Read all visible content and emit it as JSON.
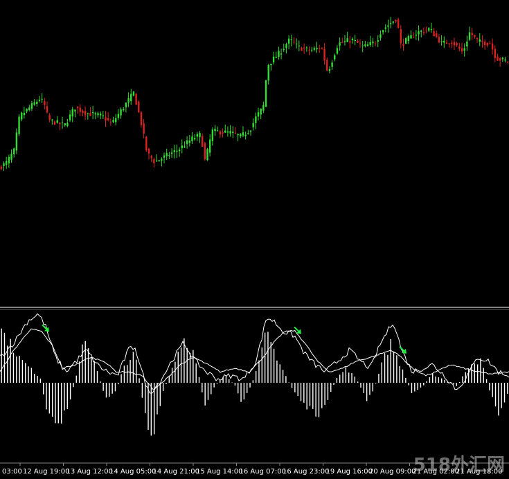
{
  "colors": {
    "background": "#000000",
    "bull": "#33dd33",
    "bear": "#dd2222",
    "separator": "#ffffff",
    "indicator": "#ffffff",
    "arrow": "#22ee44",
    "text": "#ffffff"
  },
  "watermark": "518外汇网",
  "chart_data": [
    {
      "type": "candlestick",
      "title": "",
      "grid": false,
      "ylim": [
        0,
        100
      ],
      "x_tick_labels": [
        "03:00",
        "12 Aug 19:00",
        "13 Aug 12:00",
        "14 Aug 05:00",
        "14 Aug 21:00",
        "15 Aug 14:00",
        "16 Aug 07:00",
        "16 Aug 23:00",
        "19 Aug 16:00",
        "20 Aug 09:00",
        "21 Aug 02:00",
        "21 Aug 18:00"
      ],
      "price_path": [
        [
          0,
          22
        ],
        [
          10,
          24
        ],
        [
          22,
          31
        ],
        [
          30,
          50
        ],
        [
          45,
          55
        ],
        [
          60,
          60
        ],
        [
          66,
          56
        ],
        [
          72,
          48
        ],
        [
          95,
          45
        ],
        [
          110,
          55
        ],
        [
          125,
          52
        ],
        [
          150,
          50
        ],
        [
          163,
          46
        ],
        [
          180,
          55
        ],
        [
          195,
          63
        ],
        [
          206,
          46
        ],
        [
          214,
          30
        ],
        [
          225,
          25
        ],
        [
          240,
          28
        ],
        [
          260,
          32
        ],
        [
          280,
          38
        ],
        [
          292,
          40
        ],
        [
          298,
          25
        ],
        [
          308,
          42
        ],
        [
          335,
          41
        ],
        [
          350,
          39
        ],
        [
          363,
          43
        ],
        [
          372,
          50
        ],
        [
          382,
          55
        ],
        [
          388,
          78
        ],
        [
          398,
          82
        ],
        [
          406,
          85
        ],
        [
          420,
          92
        ],
        [
          432,
          88
        ],
        [
          450,
          86
        ],
        [
          466,
          88
        ],
        [
          475,
          74
        ],
        [
          490,
          90
        ],
        [
          510,
          92
        ],
        [
          527,
          88
        ],
        [
          545,
          91
        ],
        [
          552,
          97
        ],
        [
          562,
          100
        ],
        [
          575,
          104
        ],
        [
          580,
          89
        ],
        [
          590,
          92
        ],
        [
          605,
          96
        ],
        [
          622,
          98
        ],
        [
          640,
          90
        ],
        [
          655,
          91
        ],
        [
          670,
          85
        ],
        [
          680,
          96
        ],
        [
          692,
          91
        ],
        [
          710,
          90
        ],
        [
          718,
          82
        ],
        [
          735,
          80
        ]
      ],
      "candle_count": 200,
      "vertical_scale": 1.0
    },
    {
      "type": "histogram+line",
      "title": "",
      "grid": false,
      "ylim": [
        -1,
        1
      ],
      "histogram_path": [
        [
          0,
          0.75
        ],
        [
          30,
          0.32
        ],
        [
          60,
          0.05
        ],
        [
          65,
          -0.35
        ],
        [
          80,
          -0.62
        ],
        [
          98,
          -0.35
        ],
        [
          112,
          0.15
        ],
        [
          120,
          0.55
        ],
        [
          135,
          0.35
        ],
        [
          152,
          -0.22
        ],
        [
          168,
          -0.1
        ],
        [
          180,
          0.25
        ],
        [
          195,
          0.4
        ],
        [
          210,
          -0.45
        ],
        [
          220,
          -0.82
        ],
        [
          235,
          -0.15
        ],
        [
          250,
          0.25
        ],
        [
          265,
          0.62
        ],
        [
          280,
          0.4
        ],
        [
          296,
          -0.3
        ],
        [
          310,
          -0.05
        ],
        [
          325,
          0.12
        ],
        [
          340,
          -0.05
        ],
        [
          350,
          -0.3
        ],
        [
          360,
          -0.1
        ],
        [
          372,
          0.2
        ],
        [
          385,
          0.7
        ],
        [
          400,
          0.35
        ],
        [
          420,
          -0.05
        ],
        [
          438,
          -0.28
        ],
        [
          455,
          -0.45
        ],
        [
          470,
          -0.35
        ],
        [
          485,
          0.05
        ],
        [
          500,
          0.2
        ],
        [
          515,
          0.05
        ],
        [
          530,
          -0.25
        ],
        [
          540,
          -0.1
        ],
        [
          550,
          0.25
        ],
        [
          565,
          0.55
        ],
        [
          580,
          0.2
        ],
        [
          595,
          -0.15
        ],
        [
          610,
          -0.05
        ],
        [
          625,
          0.12
        ],
        [
          640,
          0.05
        ],
        [
          660,
          -0.05
        ],
        [
          680,
          0.28
        ],
        [
          695,
          0.3
        ],
        [
          710,
          -0.2
        ],
        [
          722,
          -0.45
        ],
        [
          735,
          -0.1
        ]
      ],
      "signal_path": [
        [
          0,
          0.15
        ],
        [
          20,
          0.45
        ],
        [
          45,
          0.75
        ],
        [
          60,
          0.7
        ],
        [
          75,
          0.52
        ],
        [
          90,
          0.2
        ],
        [
          110,
          0.25
        ],
        [
          130,
          0.35
        ],
        [
          150,
          0.3
        ],
        [
          168,
          0.15
        ],
        [
          185,
          0.15
        ],
        [
          205,
          0.1
        ],
        [
          222,
          -0.1
        ],
        [
          240,
          0.05
        ],
        [
          260,
          0.25
        ],
        [
          280,
          0.35
        ],
        [
          300,
          0.25
        ],
        [
          318,
          0.15
        ],
        [
          340,
          0.2
        ],
        [
          360,
          0.15
        ],
        [
          380,
          0.35
        ],
        [
          395,
          0.55
        ],
        [
          410,
          0.7
        ],
        [
          425,
          0.72
        ],
        [
          440,
          0.55
        ],
        [
          458,
          0.3
        ],
        [
          475,
          0.15
        ],
        [
          495,
          0.2
        ],
        [
          515,
          0.3
        ],
        [
          535,
          0.35
        ],
        [
          550,
          0.4
        ],
        [
          565,
          0.45
        ],
        [
          580,
          0.35
        ],
        [
          595,
          0.2
        ],
        [
          615,
          0.1
        ],
        [
          630,
          0.15
        ],
        [
          650,
          0.25
        ],
        [
          670,
          0.2
        ],
        [
          690,
          0.15
        ],
        [
          710,
          0.12
        ],
        [
          735,
          0.15
        ]
      ],
      "macd_path": [
        [
          0,
          0.35
        ],
        [
          20,
          0.55
        ],
        [
          40,
          0.85
        ],
        [
          55,
          0.95
        ],
        [
          65,
          0.8
        ],
        [
          80,
          0.35
        ],
        [
          95,
          0.15
        ],
        [
          110,
          0.3
        ],
        [
          125,
          0.45
        ],
        [
          140,
          0.25
        ],
        [
          155,
          0.15
        ],
        [
          170,
          0.1
        ],
        [
          185,
          0.45
        ],
        [
          195,
          0.5
        ],
        [
          205,
          0.15
        ],
        [
          215,
          -0.15
        ],
        [
          230,
          0.0
        ],
        [
          248,
          0.3
        ],
        [
          265,
          0.55
        ],
        [
          282,
          0.3
        ],
        [
          298,
          0.15
        ],
        [
          315,
          0.05
        ],
        [
          332,
          0.1
        ],
        [
          352,
          0.05
        ],
        [
          370,
          0.3
        ],
        [
          385,
          0.9
        ],
        [
          395,
          0.85
        ],
        [
          410,
          0.7
        ],
        [
          425,
          0.65
        ],
        [
          440,
          0.4
        ],
        [
          455,
          0.25
        ],
        [
          470,
          0.15
        ],
        [
          488,
          0.3
        ],
        [
          505,
          0.45
        ],
        [
          520,
          0.3
        ],
        [
          535,
          0.2
        ],
        [
          550,
          0.55
        ],
        [
          568,
          0.85
        ],
        [
          580,
          0.45
        ],
        [
          595,
          0.15
        ],
        [
          610,
          0.2
        ],
        [
          625,
          0.25
        ],
        [
          642,
          0.1
        ],
        [
          660,
          -0.1
        ],
        [
          675,
          0.1
        ],
        [
          690,
          0.35
        ],
        [
          705,
          0.3
        ],
        [
          720,
          0.15
        ],
        [
          735,
          0.1
        ]
      ],
      "bar_count": 170,
      "arrows_x": [
        66,
        430,
        582
      ],
      "arrow_levels": [
        0.75,
        0.72,
        0.45
      ]
    }
  ]
}
